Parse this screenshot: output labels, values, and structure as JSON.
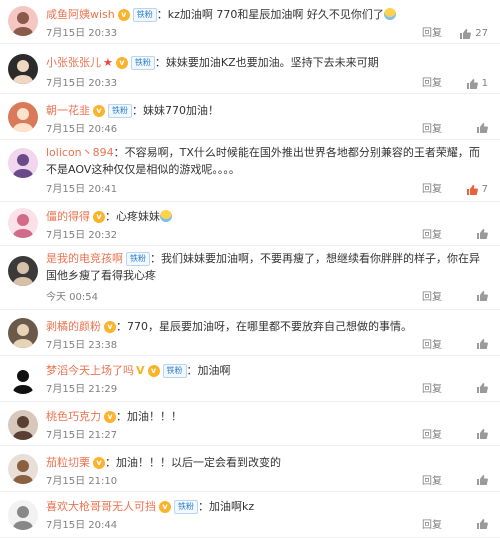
{
  "comments": [
    {
      "name": "咸鱼阿姨wish",
      "badge": "lv",
      "fan": "铁粉",
      "text": "：kz加油啊 770和星辰加油啊 好久不见你们了",
      "emoji": "cry",
      "time": "7月15日 20:33",
      "reply": "回复",
      "likes": "27",
      "liked": false
    },
    {
      "name": "小张张张儿",
      "badge": "lv",
      "extra": "star",
      "fan": "铁粉",
      "text": "：妹妹要加油KZ也要加油。坚持下去未来可期",
      "time": "7月15日 20:33",
      "reply": "回复",
      "likes": "1",
      "liked": false
    },
    {
      "name": "朝一花韭",
      "badge": "lv",
      "fan": "铁粉",
      "text": "：妹妹770加油！",
      "time": "7月15日 20:46",
      "reply": "回复",
      "likes": "",
      "liked": false
    },
    {
      "name": "lolicon丶894",
      "text": "：不容易啊，TX什么时候能在国外推出世界各地都分别兼容的王者荣耀，而不是AOV这种仅仅是相似的游戏呢。。。。",
      "time": "7月15日 20:41",
      "reply": "回复",
      "likes": "7",
      "liked": true
    },
    {
      "name": "僵的得得",
      "badge": "lv",
      "text": "：心疼妹妹",
      "emoji": "cry",
      "time": "7月15日 20:32",
      "reply": "回复",
      "likes": "",
      "liked": false
    },
    {
      "name": "是我的电竞孩啊",
      "fan": "铁粉",
      "text": "：我们妹妹要加油啊，不要再瘦了，想继续看你胖胖的样子，你在异国他乡瘦了看得我心疼",
      "time": "今天 00:54",
      "reply": "回复",
      "likes": "",
      "liked": false
    },
    {
      "name": "剥橘的颜粉",
      "badge": "lv",
      "text": "：770，星辰要加油呀，在哪里都不要放弃自己想做的事情。",
      "time": "7月15日 23:38",
      "reply": "回复",
      "likes": "",
      "liked": false
    },
    {
      "name": "梦滔今天上场了吗",
      "extra": "v",
      "badge": "lv",
      "fan": "铁粉",
      "text": "：加油啊",
      "time": "7月15日 21:29",
      "reply": "回复",
      "likes": "",
      "liked": false
    },
    {
      "name": "桃色巧克力",
      "badge": "lv",
      "text": "：加油！！！",
      "time": "7月15日 21:27",
      "reply": "回复",
      "likes": "",
      "liked": false
    },
    {
      "name": "茄粒切栗",
      "badge": "lv",
      "text": "：加油！！！以后一定会看到改变的",
      "time": "7月15日 21:10",
      "reply": "回复",
      "likes": "",
      "liked": false
    },
    {
      "name": "喜欢大枪哥哥无人可挡",
      "badge": "lv",
      "fan": "铁粉",
      "text": "：加油啊kz",
      "time": "7月15日 20:44",
      "reply": "回复",
      "likes": "",
      "liked": false
    }
  ],
  "colors": {
    "name": "#eb7350",
    "liked": "#e8603c",
    "meta": "#808080"
  },
  "icons": {
    "like": "thumbs-up-icon",
    "level": "level-badge-icon",
    "fan": "fan-badge"
  }
}
